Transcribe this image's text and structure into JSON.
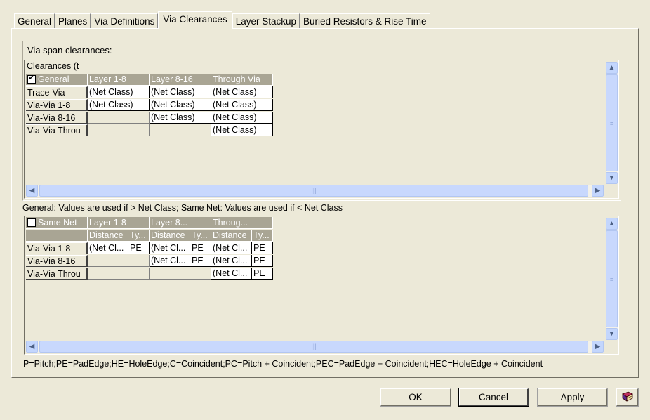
{
  "tabs": [
    "General",
    "Planes",
    "Via Definitions",
    "Via Clearances",
    "Layer Stackup",
    "Buried Resistors & Rise Time"
  ],
  "active_tab": "Via Clearances",
  "via_span": {
    "label": "Via span clearances:",
    "caption": "Clearances (t"
  },
  "grid1": {
    "corner": "General",
    "corner_checked": true,
    "columns": [
      "Layer 1-8",
      "Layer 8-16",
      "Through Via"
    ],
    "rows": [
      {
        "label": "Trace-Via",
        "cells": [
          "(Net Class)",
          "(Net Class)",
          "(Net Class)"
        ]
      },
      {
        "label": "Via-Via 1-8",
        "cells": [
          "(Net Class)",
          "(Net Class)",
          "(Net Class)"
        ]
      },
      {
        "label": "Via-Via 8-16",
        "cells": [
          "",
          "(Net Class)",
          "(Net Class)"
        ]
      },
      {
        "label": "Via-Via Throu",
        "cells": [
          "",
          "",
          "(Net Class)"
        ]
      }
    ]
  },
  "general_note": "General: Values are used if > Net Class;  Same Net: Values are used if < Net Class",
  "grid2": {
    "corner": "Same Net",
    "corner_checked": false,
    "columns": [
      "Layer 1-8",
      "Layer 8...",
      "Throug..."
    ],
    "subcolumns": [
      "Distance",
      "Ty...",
      "Distance",
      "Ty...",
      "Distance",
      "Ty..."
    ],
    "rows": [
      {
        "label": "Via-Via 1-8",
        "cells": [
          "(Net Cl...",
          "PE",
          "(Net Cl...",
          "PE",
          "(Net Cl...",
          "PE"
        ]
      },
      {
        "label": "Via-Via 8-16",
        "cells": [
          "",
          "",
          "(Net Cl...",
          "PE",
          "(Net Cl...",
          "PE"
        ]
      },
      {
        "label": "Via-Via Throu",
        "cells": [
          "",
          "",
          "",
          "",
          "(Net Cl...",
          "PE"
        ]
      }
    ]
  },
  "legend": "P=Pitch;PE=PadEdge;HE=HoleEdge;C=Coincident;PC=Pitch + Coincident;PEC=PadEdge + Coincident;HEC=HoleEdge + Coincident",
  "buttons": {
    "ok": "OK",
    "cancel": "Cancel",
    "apply": "Apply"
  },
  "icons": {
    "help": "help-book-icon",
    "up": "▲",
    "down": "▼",
    "left": "◀",
    "right": "▶",
    "grip_v": "≡",
    "grip_h": "|||"
  }
}
